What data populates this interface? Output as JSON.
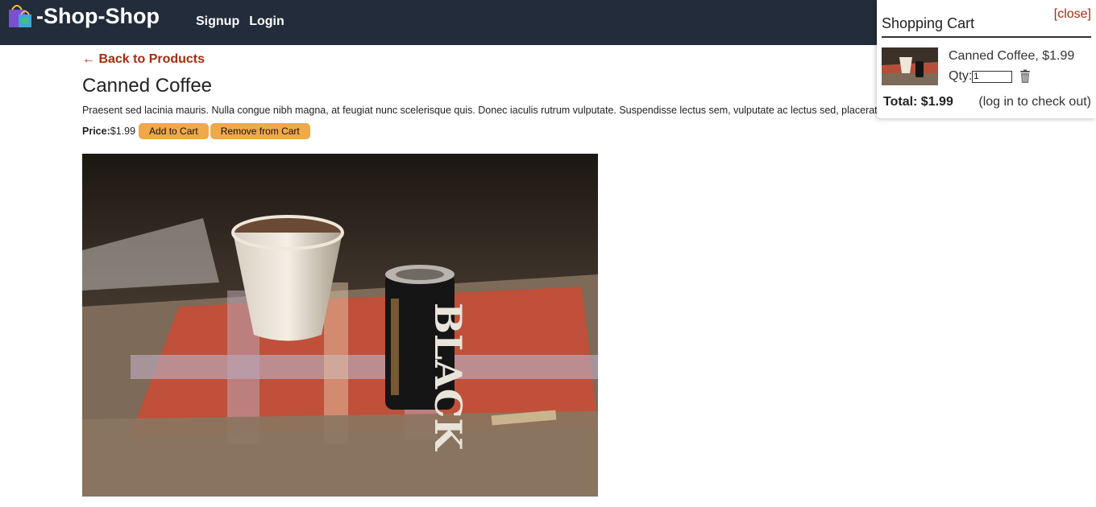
{
  "header": {
    "title": "-Shop-Shop",
    "logo_icon": "shopping-bags-icon",
    "nav": [
      {
        "label": "Signup"
      },
      {
        "label": "Login"
      }
    ]
  },
  "product": {
    "back_link": "← Back to Products",
    "name": "Canned Coffee",
    "description": "Praesent sed lacinia mauris. Nulla congue nibh magna, at feugiat nunc scelerisque quis. Donec iaculis rutrum vulputate. Suspendisse lectus sem, vulputate ac lectus sed, placerat consequat dui.",
    "price_label": "Price:",
    "price": "$1.99",
    "add_button": "Add to Cart",
    "remove_button": "Remove from Cart",
    "image_icon": "canned-coffee-photo"
  },
  "cart": {
    "close_label": "[close]",
    "title": "Shopping Cart",
    "items": [
      {
        "name_price": "Canned Coffee, $1.99",
        "qty_label": "Qty:",
        "qty_value": "1"
      }
    ],
    "trash_icon": "trash-icon",
    "total": "Total: $1.99",
    "checkout_note": "(log in to check out)"
  },
  "colors": {
    "header_bg": "#222c3a",
    "accent_link": "#a62c0f",
    "button_bg": "#f0a848"
  }
}
